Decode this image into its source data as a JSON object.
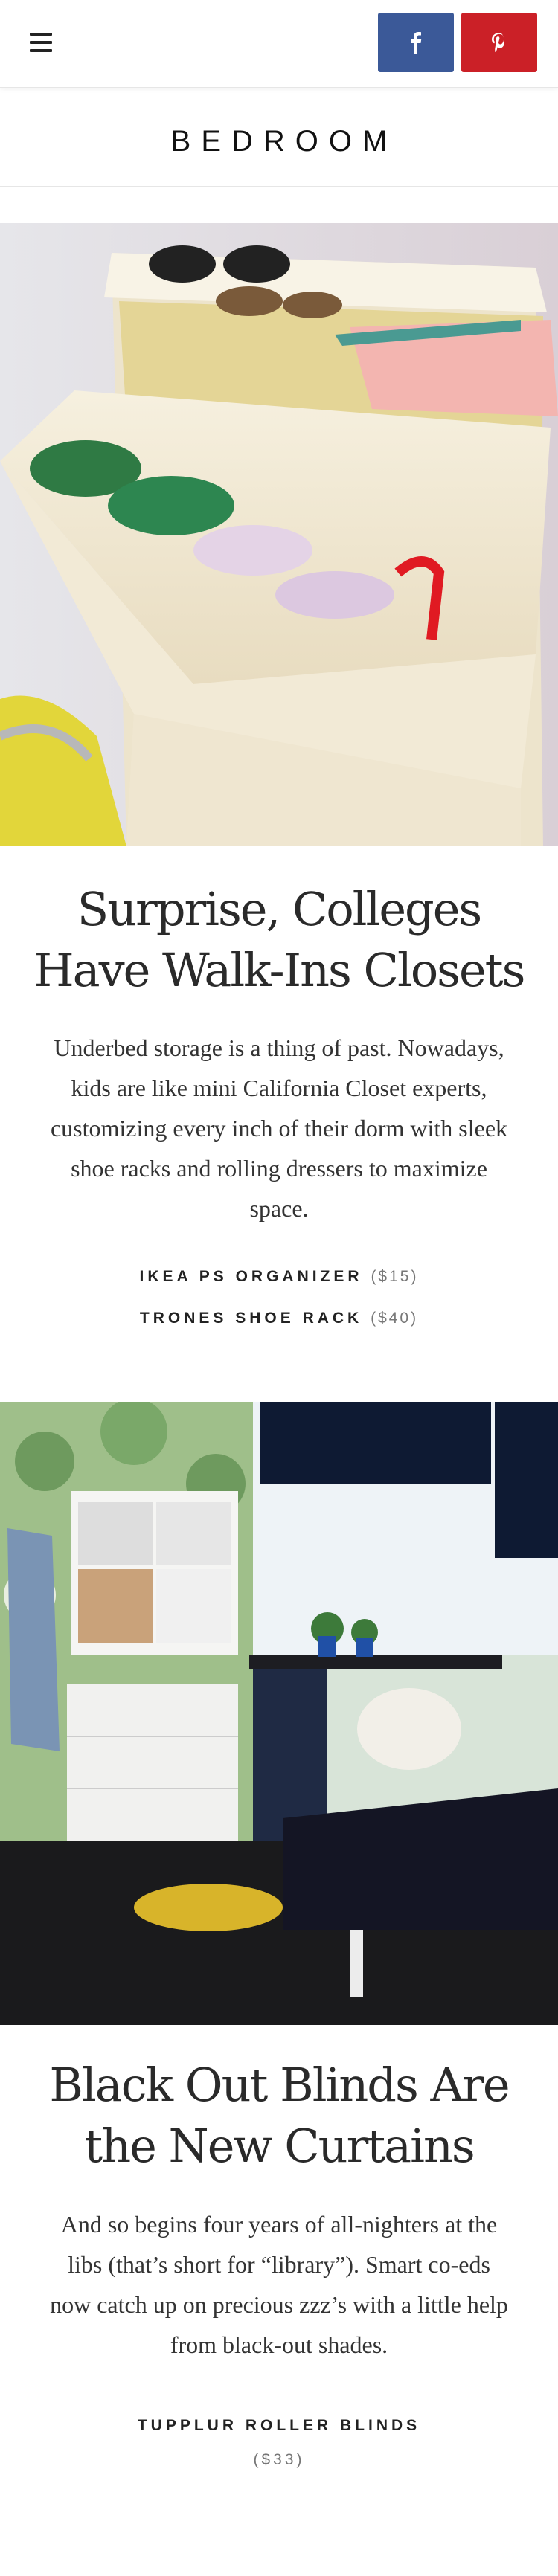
{
  "header": {
    "menu_icon": "hamburger-icon",
    "facebook_icon": "facebook-icon",
    "pinterest_icon": "pinterest-icon",
    "facebook_color": "#3b5998",
    "pinterest_color": "#cb2027"
  },
  "section": {
    "title": "BEDROOM"
  },
  "articles": [
    {
      "headline": "Surprise, Colleges Have Walk-Ins Closets",
      "body": "Underbed storage is a thing of past. Nowadays, kids are like mini California Closet experts, customizing every inch of their dorm with sleek shoe racks and rolling dressers to maximize space.",
      "products": [
        {
          "name": "IKEA PS ORGANIZER",
          "price": "($15)"
        },
        {
          "name": "TRONES SHOE RACK",
          "price": "($40)"
        }
      ]
    },
    {
      "headline": "Black Out Blinds Are the New Curtains",
      "body": "And so begins four years of all-nighters at the libs (that’s short for “library”). Smart co-eds now catch up on precious zzz’s with a little help from black-out shades.",
      "products": [
        {
          "name": "TUPPLUR ROLLER BLINDS",
          "price": "($33)"
        }
      ]
    }
  ]
}
